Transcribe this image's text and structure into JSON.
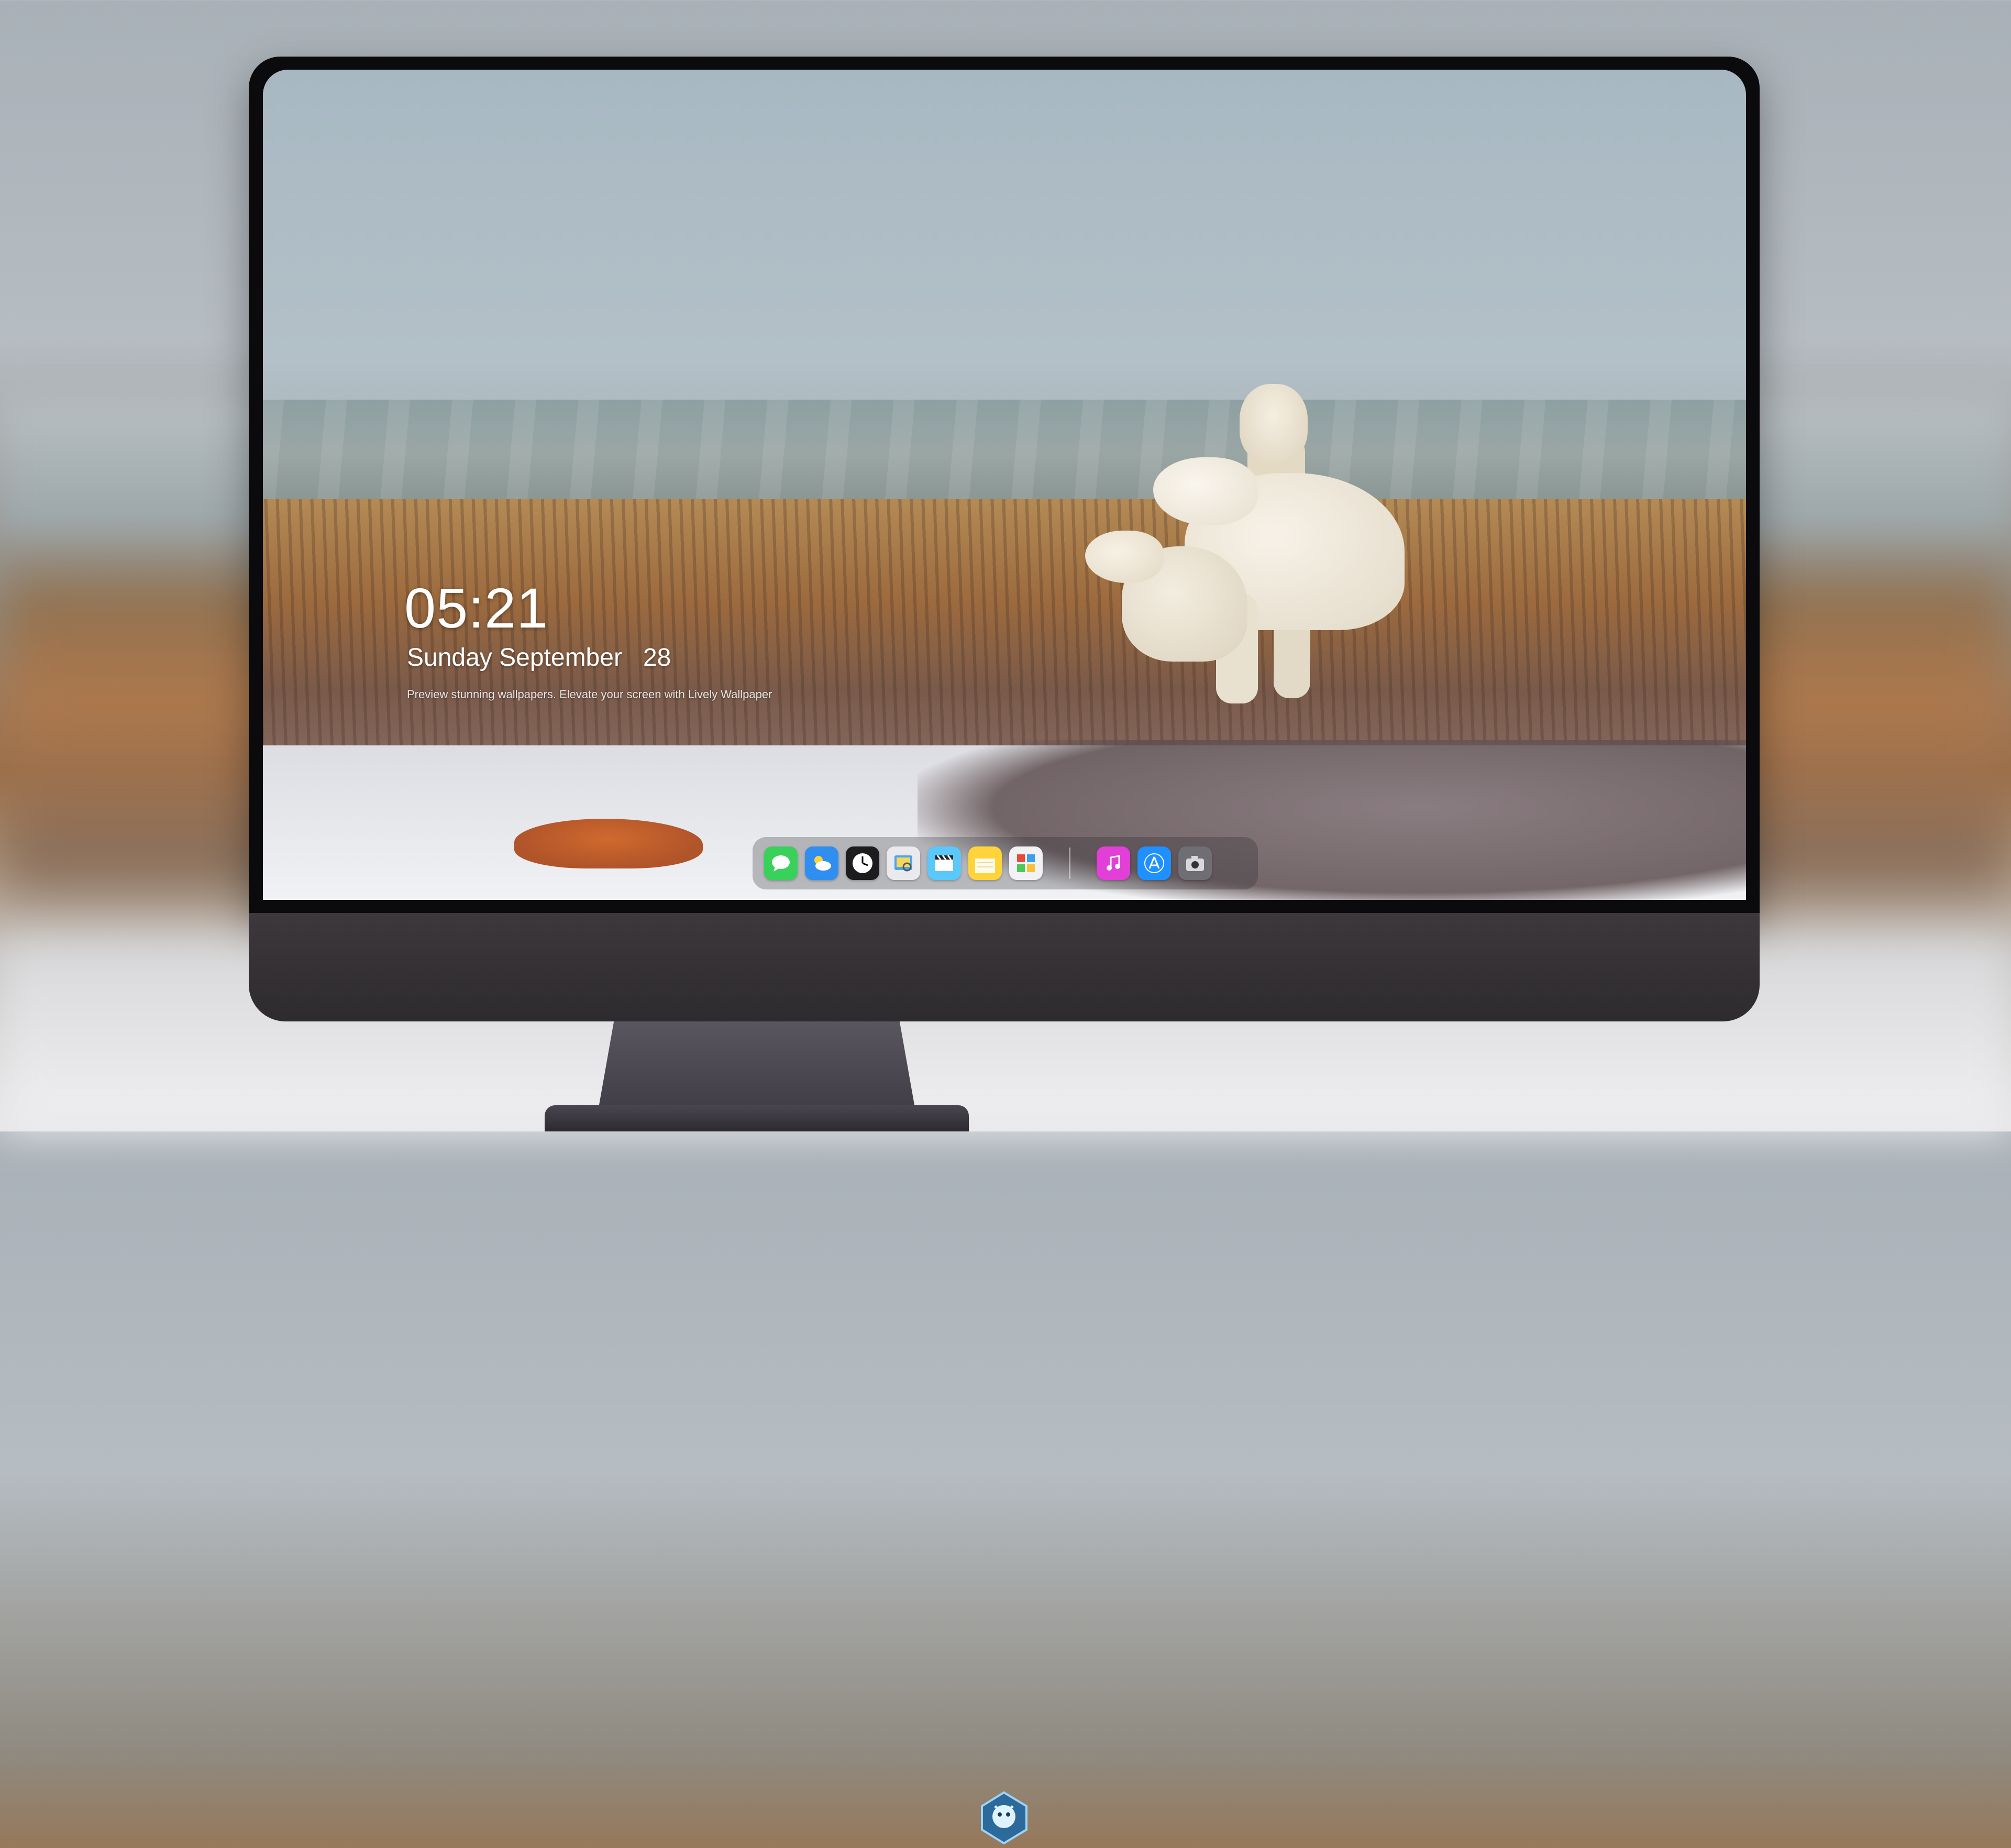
{
  "lockscreen": {
    "time": "05:21",
    "date": "Sunday September   28",
    "caption": "Preview stunning wallpapers. Elevate your screen with Lively Wallpaper"
  },
  "dock": {
    "apps": [
      {
        "name": "messages",
        "icon": "messages-icon",
        "color": "#3ad15a"
      },
      {
        "name": "weather",
        "icon": "weather-icon",
        "color": "#2f8ef0"
      },
      {
        "name": "clock",
        "icon": "clock-icon",
        "color": "#1c1c1e"
      },
      {
        "name": "preview",
        "icon": "preview-icon",
        "color": "#e9e9ee"
      },
      {
        "name": "final-cut",
        "icon": "clapper-icon",
        "color": "#5ac8fa"
      },
      {
        "name": "notes",
        "icon": "notes-icon",
        "color": "#ffd43b"
      },
      {
        "name": "photo-booth",
        "icon": "photo-booth-icon",
        "color": "#f2f2f5"
      },
      {
        "name": "music",
        "icon": "music-icon",
        "color": "#e23fd8"
      },
      {
        "name": "app-store",
        "icon": "app-store-icon",
        "color": "#1e90ff"
      },
      {
        "name": "camera",
        "icon": "camera-icon",
        "color": "#6e6e73"
      }
    ]
  },
  "colors": {
    "bezel": "#0b0b0d",
    "chin": "#3c383c",
    "rock": "#d0692e"
  }
}
